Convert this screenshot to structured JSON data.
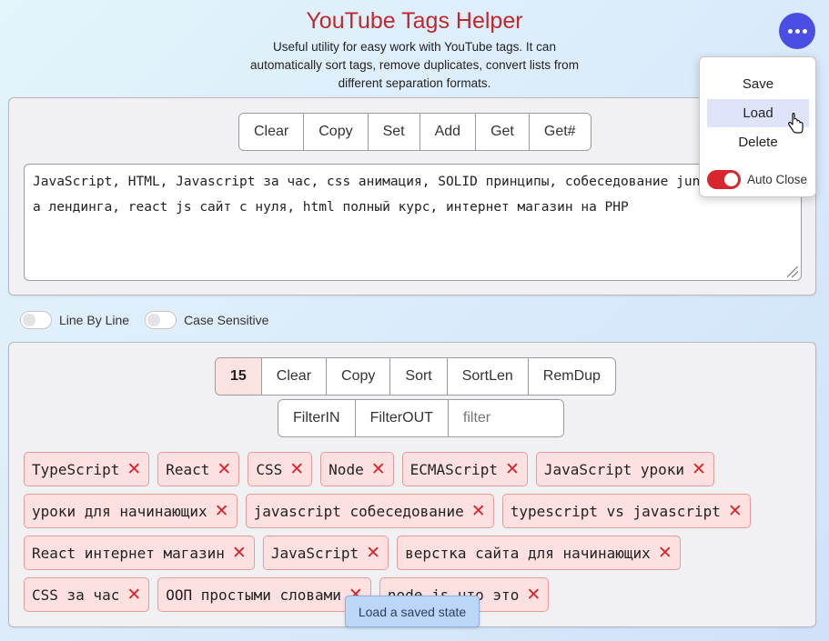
{
  "header": {
    "title": "YouTube Tags Helper",
    "subtitle": "Useful utility for easy work with YouTube tags. It can automatically sort tags, remove duplicates, convert lists from different separation formats."
  },
  "input_toolbar": {
    "buttons": [
      "Clear",
      "Copy",
      "Set",
      "Add",
      "Get",
      "Get#"
    ]
  },
  "textarea": {
    "value": "JavaScript, HTML, Javascript за час, css анимация, SOLID принципы, собеседование junior, верстка лендинга, react js сайт с нуля, html полный курс, интернет магазин на PHP"
  },
  "options": {
    "line_by_line": "Line By Line",
    "case_sensitive": "Case Sensitive"
  },
  "tags_toolbar": {
    "count": "15",
    "buttons": [
      "Clear",
      "Copy",
      "Sort",
      "SortLen",
      "RemDup"
    ]
  },
  "filter_toolbar": {
    "buttons": [
      "FilterIN",
      "FilterOUT"
    ],
    "placeholder": "filter"
  },
  "tags": [
    [
      "TypeScript",
      "React",
      "CSS",
      "Node",
      "ECMAScript",
      "JavaScript уроки"
    ],
    [
      "уроки для начинающих",
      "javascript собеседование",
      "typescript vs javascript"
    ],
    [
      "React интернет магазин",
      "JavaScript",
      "верстка сайта для начинающих"
    ],
    [
      "CSS за час",
      "ООП простыми словами",
      "node js что это"
    ]
  ],
  "tag_remove_glyph": "✕",
  "menu": {
    "items": [
      "Save",
      "Load",
      "Delete"
    ],
    "active": "Load",
    "auto_close_label": "Auto Close"
  },
  "tooltip": "Load a saved state",
  "colors": {
    "accent": "#4a4ee3",
    "title": "#c0282d",
    "tag_bg": "#fde0e0",
    "toggle_on": "#d7262d"
  }
}
